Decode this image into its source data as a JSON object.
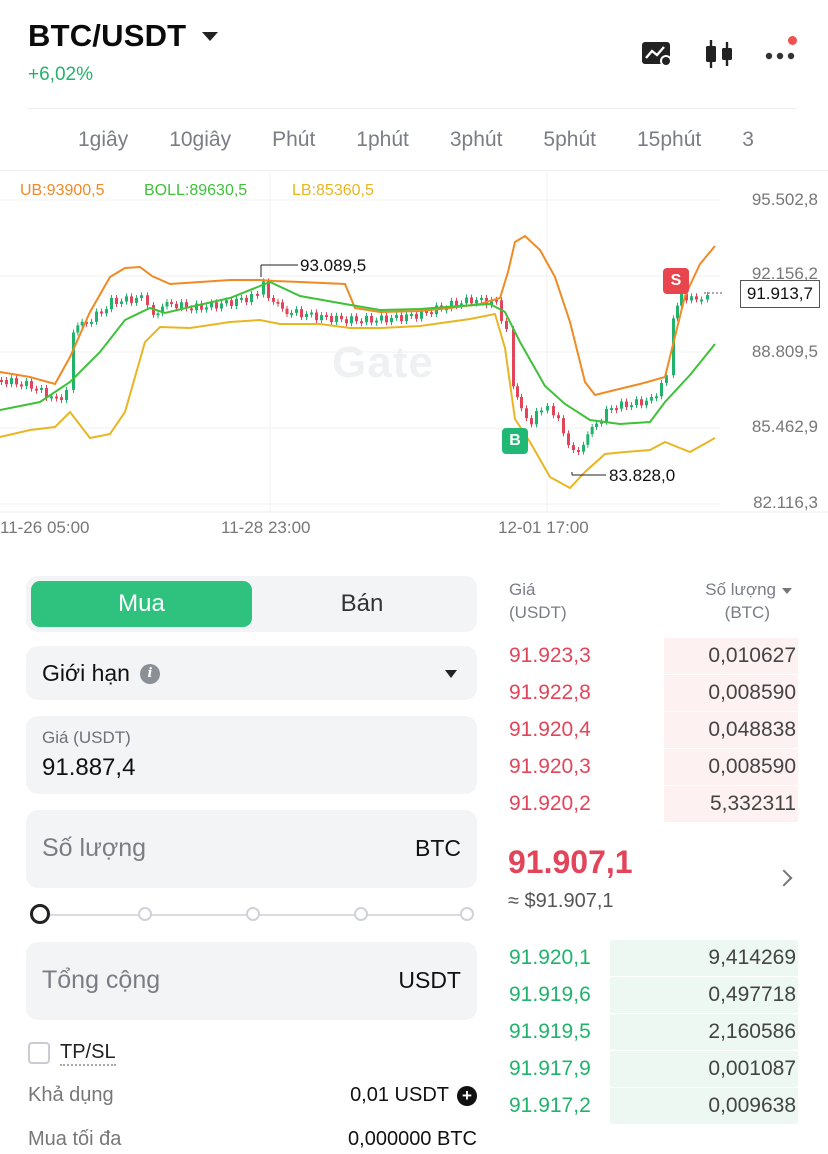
{
  "header": {
    "pair": "BTC/USDT",
    "change": "+6,02%",
    "icons": [
      "chart-settings-icon",
      "candlestick-icon",
      "more-icon"
    ]
  },
  "timeframes": [
    "1giây",
    "10giây",
    "Phút",
    "1phút",
    "3phút",
    "5phút",
    "15phút",
    "3"
  ],
  "indicators": {
    "ub": "UB:93900,5",
    "boll": "BOLL:89630,5",
    "lb": "LB:85360,5"
  },
  "chart_data": {
    "type": "line",
    "title": "",
    "y_ticks": [
      "95.502,8",
      "92.156,2",
      "88.809,5",
      "85.462,9",
      "82.116,3"
    ],
    "x_ticks": [
      "11-26 05:00",
      "11-28 23:00",
      "12-01 17:00"
    ],
    "ylim": [
      82116.3,
      95502.8
    ],
    "current_price": "91.913,7",
    "annotations": {
      "high": "93.089,5",
      "low": "83.828,0"
    },
    "markers": {
      "sell": "S",
      "buy": "B"
    },
    "watermark": "Gate",
    "series": [
      {
        "name": "UB",
        "color": "#f08a24"
      },
      {
        "name": "BOLL",
        "color": "#3fc13a"
      },
      {
        "name": "LB",
        "color": "#e8b623"
      }
    ]
  },
  "form": {
    "buy_tab": "Mua",
    "sell_tab": "Bán",
    "order_type": "Giới hạn",
    "info_glyph": "i",
    "price_label": "Giá (USDT)",
    "price_value": "91.887,4",
    "qty_placeholder": "Số lượng",
    "qty_unit": "BTC",
    "total_placeholder": "Tổng cộng",
    "total_unit": "USDT",
    "tpsl_label": "TP/SL",
    "available_label": "Khả dụng",
    "available_value": "0,01 USDT",
    "plus_glyph": "+",
    "max_buy_label": "Mua tối đa",
    "max_buy_value": "0,000000 BTC"
  },
  "orderbook": {
    "price_header_1": "Giá",
    "price_header_2": "(USDT)",
    "qty_header_1": "Số lượng",
    "qty_header_2": "(BTC)",
    "asks": [
      {
        "price": "91.923,3",
        "qty": "0,010627",
        "depth": 0.45
      },
      {
        "price": "91.922,8",
        "qty": "0,008590",
        "depth": 0.45
      },
      {
        "price": "91.920,4",
        "qty": "0,048838",
        "depth": 0.45
      },
      {
        "price": "91.920,3",
        "qty": "0,008590",
        "depth": 0.45
      },
      {
        "price": "91.920,2",
        "qty": "5,332311",
        "depth": 0.45
      }
    ],
    "last_price": "91.907,1",
    "last_usd": "≈ $91.907,1",
    "bids": [
      {
        "price": "91.920,1",
        "qty": "9,414269",
        "depth": 0.63
      },
      {
        "price": "91.919,6",
        "qty": "0,497718",
        "depth": 0.63
      },
      {
        "price": "91.919,5",
        "qty": "2,160586",
        "depth": 0.63
      },
      {
        "price": "91.917,9",
        "qty": "0,001087",
        "depth": 0.63
      },
      {
        "price": "91.917,2",
        "qty": "0,009638",
        "depth": 0.63
      }
    ]
  }
}
